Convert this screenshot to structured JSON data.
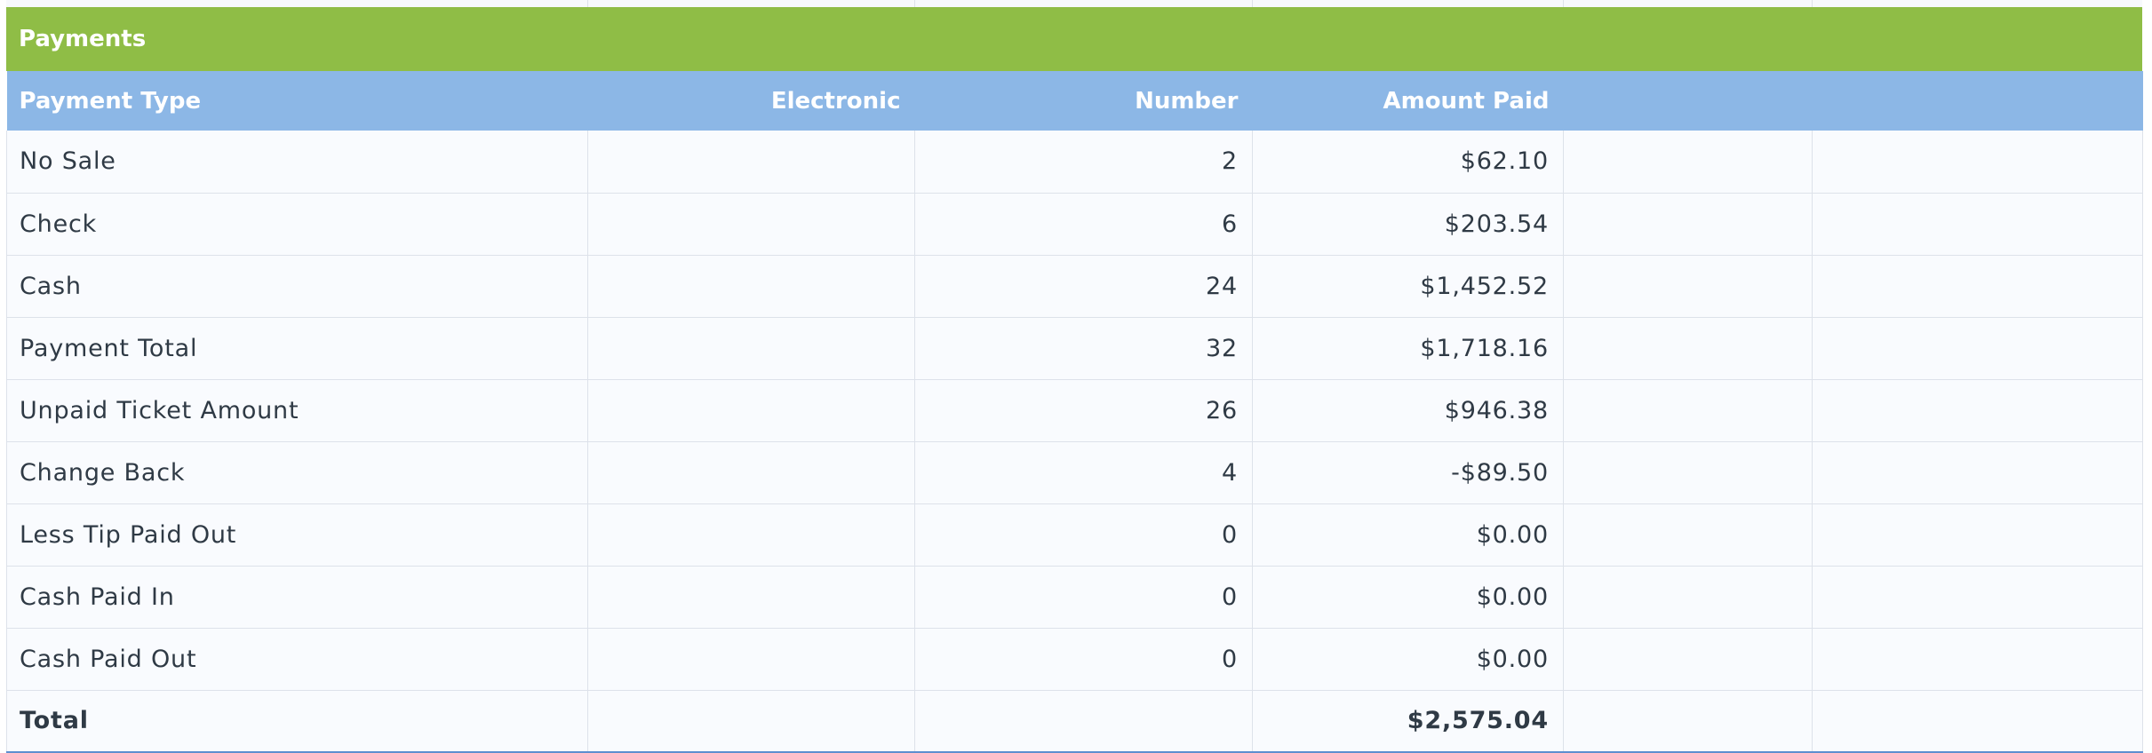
{
  "section": {
    "title": "Payments"
  },
  "table": {
    "headers": [
      "Payment Type",
      "Electronic",
      "Number",
      "Amount Paid",
      "",
      ""
    ],
    "rows": [
      {
        "type": "No Sale",
        "electronic": "",
        "number": "2",
        "amount": "$62.10"
      },
      {
        "type": "Check",
        "electronic": "",
        "number": "6",
        "amount": "$203.54"
      },
      {
        "type": "Cash",
        "electronic": "",
        "number": "24",
        "amount": "$1,452.52"
      },
      {
        "type": "Payment Total",
        "electronic": "",
        "number": "32",
        "amount": "$1,718.16"
      },
      {
        "type": "Unpaid Ticket Amount",
        "electronic": "",
        "number": "26",
        "amount": "$946.38"
      },
      {
        "type": "Change Back",
        "electronic": "",
        "number": "4",
        "amount": "-$89.50"
      },
      {
        "type": "Less Tip Paid Out",
        "electronic": "",
        "number": "0",
        "amount": "$0.00"
      },
      {
        "type": "Cash Paid In",
        "electronic": "",
        "number": "0",
        "amount": "$0.00"
      },
      {
        "type": "Cash Paid Out",
        "electronic": "",
        "number": "0",
        "amount": "$0.00"
      }
    ],
    "total": {
      "type": "Total",
      "electronic": "",
      "number": "",
      "amount": "$2,575.04"
    }
  },
  "colors": {
    "section_header_bg": "#8fbd46",
    "table_header_bg": "#8cb7e6",
    "row_bg": "#f9fbfe",
    "grid_line": "#dde2ea",
    "text": "#2f3a45"
  }
}
